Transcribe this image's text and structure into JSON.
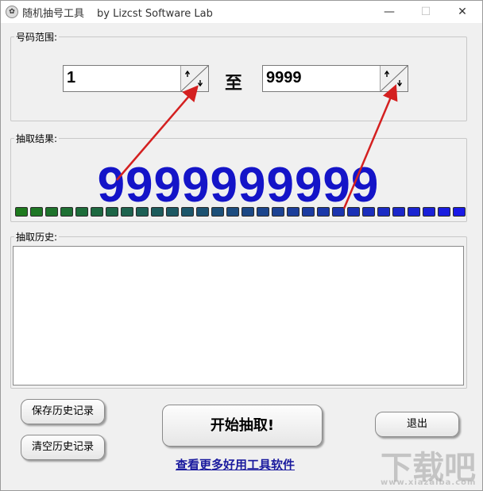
{
  "window": {
    "title": "随机抽号工具",
    "subtitle": "by Lizcst Software Lab",
    "minimize_glyph": "—",
    "maximize_glyph": "☐",
    "close_glyph": "✕"
  },
  "range": {
    "label": "号码范围:",
    "from_value": "1",
    "to_label": "至",
    "to_value": "9999"
  },
  "result": {
    "label": "抽取结果:",
    "number": "9999999999",
    "led_count": 30,
    "led_start_color": "#1e7a1e",
    "led_end_color": "#1a1ae6"
  },
  "history": {
    "label": "抽取历史:",
    "content": ""
  },
  "buttons": {
    "save_history": "保存历史记录",
    "clear_history": "清空历史记录",
    "start": "开始抽取!",
    "exit": "退出"
  },
  "footer": {
    "link_text": "查看更多好用工具软件"
  },
  "colors": {
    "result_number": "#1414c8",
    "annotation_arrow": "#d42020",
    "link": "#1a1a9e"
  },
  "watermark": {
    "text": "下载吧",
    "url": "www.xiazaiba.com"
  }
}
